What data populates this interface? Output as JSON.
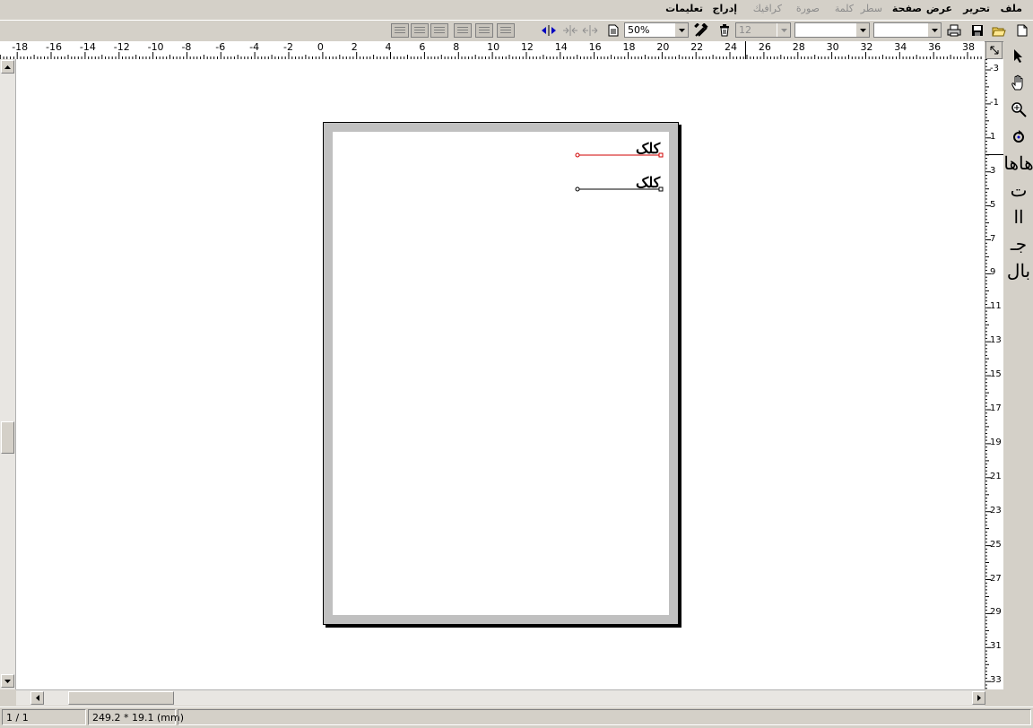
{
  "menu": {
    "items": [
      {
        "label": "ملف",
        "enabled": true
      },
      {
        "label": "تحرير",
        "enabled": true
      },
      {
        "label": "عرض",
        "enabled": true
      },
      {
        "label": "صفحة",
        "enabled": true
      },
      {
        "label": "سطر",
        "enabled": false
      },
      {
        "label": "كلمة",
        "enabled": false
      },
      {
        "label": "صورة",
        "enabled": false
      },
      {
        "label": "كرافيك",
        "enabled": false
      },
      {
        "label": "إدراج",
        "enabled": true
      },
      {
        "label": "تعليمات",
        "enabled": true
      }
    ]
  },
  "toolbar": {
    "zoom_value": "50%",
    "font_size_value": "12",
    "icons": [
      "new-file-icon",
      "open-folder-icon",
      "save-icon",
      "print-icon",
      "delete-icon",
      "tools-icon",
      "page-icon",
      "text-direction-icon",
      "align-inward-icon",
      "align-outward-icon"
    ]
  },
  "ruler": {
    "horizontal_labels": [
      "38",
      "36",
      "34",
      "32",
      "30",
      "28",
      "26",
      "24",
      "22",
      "20",
      "18",
      "16",
      "14",
      "12",
      "10",
      "8",
      "6",
      "4",
      "2",
      "0",
      "-2",
      "-4",
      "-6",
      "-8",
      "-10",
      "-12",
      "-14",
      "-16",
      "-18"
    ],
    "vertical_labels": [
      "-3",
      "-1",
      "1",
      "3",
      "5",
      "7",
      "9",
      "11",
      "13",
      "15",
      "17",
      "19",
      "21",
      "23",
      "25",
      "27",
      "29",
      "31",
      "33"
    ]
  },
  "document": {
    "lines": [
      {
        "text": "کلک",
        "selected": true
      },
      {
        "text": "کلک",
        "selected": false
      }
    ]
  },
  "palette": {
    "tools": [
      {
        "icon": "pointer-icon",
        "glyph": ""
      },
      {
        "icon": "hand-icon",
        "glyph": ""
      },
      {
        "icon": "zoom-icon",
        "glyph": ""
      },
      {
        "icon": "rotate-icon",
        "glyph": ""
      },
      {
        "icon": "glyph-tool-1",
        "glyph": "هاها"
      },
      {
        "icon": "glyph-tool-2",
        "glyph": "ت"
      },
      {
        "icon": "glyph-tool-3",
        "glyph": "اا"
      },
      {
        "icon": "glyph-tool-4",
        "glyph": "جـ"
      },
      {
        "icon": "glyph-tool-5",
        "glyph": "بال"
      }
    ]
  },
  "status": {
    "page": "1 / 1",
    "dimensions": "249.2 * 19.1 (mm)"
  },
  "colors": {
    "selection": "#d00000",
    "workspace": "#ffffff",
    "page_border": "#c0c0c0"
  }
}
